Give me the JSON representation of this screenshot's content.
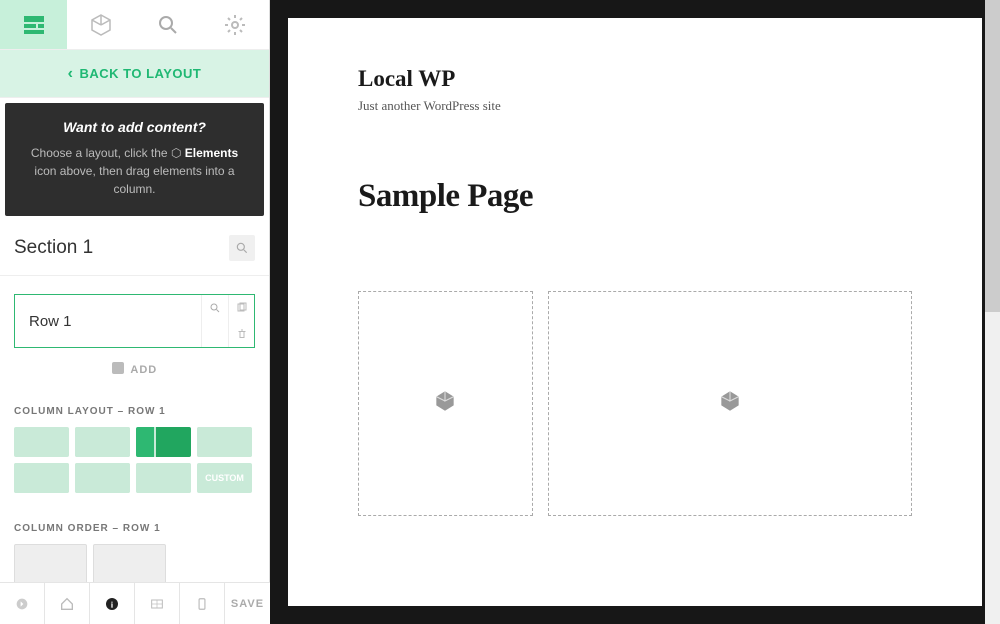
{
  "back_label": "BACK TO LAYOUT",
  "help": {
    "title": "Want to add content?",
    "desc_pre": "Choose a layout, click the ",
    "desc_mid": "Elements",
    "desc_post": " icon above, then drag elements into a column."
  },
  "section": {
    "name": "Section 1"
  },
  "row": {
    "name": "Row 1"
  },
  "add_label": "ADD",
  "column_layout_label": "COLUMN LAYOUT – ROW 1",
  "column_order_label": "COLUMN ORDER – ROW 1",
  "custom_label": "CUSTOM",
  "save_label": "SAVE",
  "preview": {
    "site_title": "Local WP",
    "site_tagline": "Just another WordPress site",
    "page_title": "Sample Page"
  }
}
